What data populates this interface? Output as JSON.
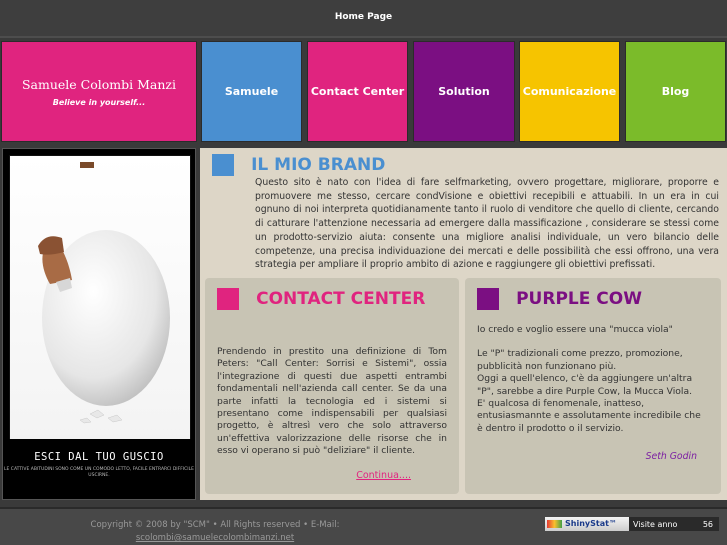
{
  "topbar": {
    "home_label": "Home Page"
  },
  "header": {
    "brand_name": "Samuele Colombi Manzi",
    "tagline": "Believe in yourself...",
    "brand_color": "#e0247f",
    "nav": [
      {
        "label": "Samuele",
        "color": "#4a8fd0"
      },
      {
        "label": "Contact Center",
        "color": "#e0247f"
      },
      {
        "label": "Solution",
        "color": "#7b0f82"
      },
      {
        "label": "Comunicazione",
        "color": "#f6c400"
      },
      {
        "label": "Blog",
        "color": "#7bbb2a"
      }
    ]
  },
  "poster": {
    "title": "ESCI DAL TUO GUSCIO",
    "subtitle": "LE CATTIVE ABITUDINI SONO COME UN COMODO LETTO, FACILE ENTRARCI DIFFICILE USCIRNE."
  },
  "brand_section": {
    "title": "IL MIO BRAND",
    "square_color": "#4a8fd0",
    "title_color": "#4a8fd0",
    "text": "Questo sito è nato con l'idea di fare selfmarketing, ovvero progettare, migliorare, proporre e promuovere me stesso, cercare condVisione e obiettivi recepibili e attuabili. In un era in cui ognuno di noi interpreta quotidianamente tanto il ruolo di venditore che quello di cliente, cercando di catturare l'attenzione necessaria ad emergere dalla massificazione , considerare se stessi come un prodotto-servizio aiuta: consente una migliore analisi individuale, un vero bilancio delle competenze, una precisa individuazione dei mercati e delle possibilità che essi offrono, una vera strategia per ampliare il proprio ambito di azione e raggiungere gli obiettivi prefissati."
  },
  "contact_section": {
    "title": "CONTACT CENTER",
    "square_color": "#e0247f",
    "title_color": "#e0247f",
    "text": "Prendendo in prestito una definizione di Tom Peters: \"Call Center: Sorrisi e Sistemi\", ossia l'integrazione di questi due aspetti entrambi fondamentali nell'azienda call center. Se da una parte infatti la tecnologia ed i sistemi si presentano come indispensabili per qualsiasi progetto, è altresì vero che solo attraverso un'effettiva valorizzazione delle risorse che in esso vi operano si può \"deliziare\" il cliente.",
    "more_link": "Continua...."
  },
  "purple_section": {
    "title": "PURPLE COW",
    "square_color": "#7b0f82",
    "title_color": "#7b0f82",
    "line1": "Io credo e voglio essere una \"mucca viola\"",
    "line2": "Le \"P\" tradizionali come prezzo, promozione, pubblicità non funzionano più.",
    "line3": "Oggi a quell'elenco, c'è da aggiungere un'altra \"P\", sarebbe a dire Purple Cow, la Mucca Viola.",
    "line4": "E' qualcosa di fenomenale, inatteso, entusiasmannte e assolutamente incredibile che è dentro il prodotto o il servizio.",
    "signature": "Seth Godin"
  },
  "footer": {
    "copyright": "Copyright © 2008 by \"SCM\"  •  All Rights reserved  •  E-Mail:",
    "email": "scolombi@samuelecolombimanzi.net",
    "stat_logo": "ShinyStat™",
    "stat_label": "Visite anno",
    "stat_value": "56"
  }
}
